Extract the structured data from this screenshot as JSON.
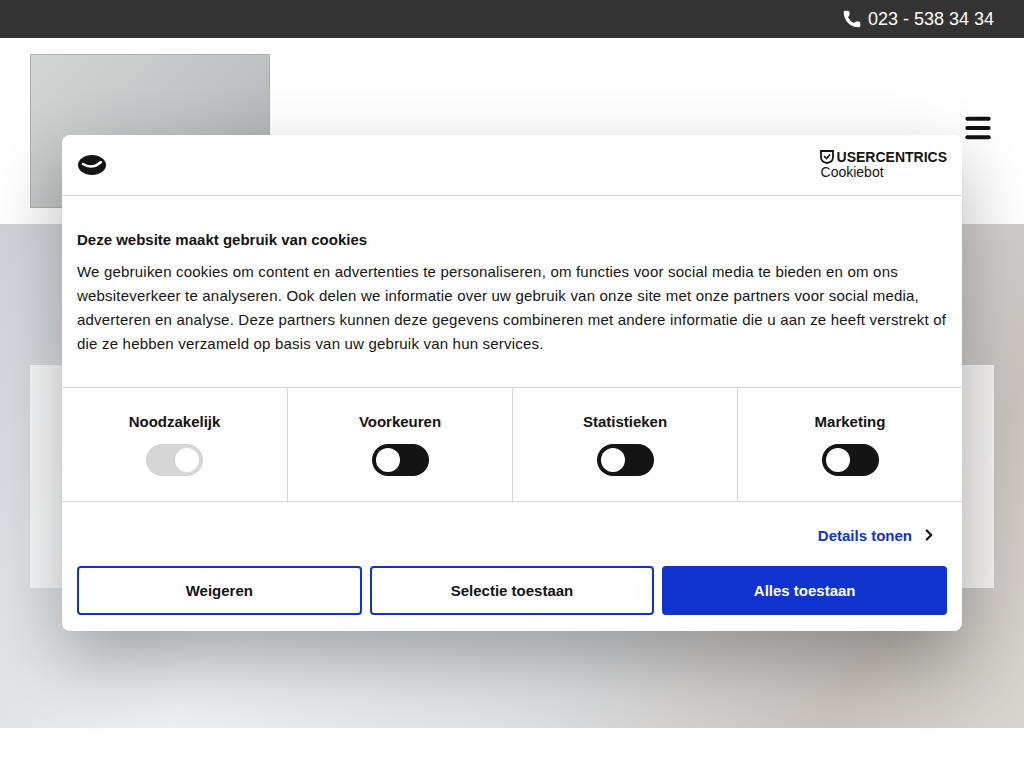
{
  "topbar": {
    "phone": "023 - 538 34 34"
  },
  "cookie_dialog": {
    "brand": {
      "name": "USERCENTRICS",
      "product": "Cookiebot"
    },
    "title": "Deze website maakt gebruik van cookies",
    "body": "We gebruiken cookies om content en advertenties te personaliseren, om functies voor social media te bieden en om ons websiteverkeer te analyseren. Ook delen we informatie over uw gebruik van onze site met onze partners voor social media, adverteren en analyse. Deze partners kunnen deze gegevens combineren met andere informatie die u aan ze heeft verstrekt of die ze hebben verzameld op basis van uw gebruik van hun services.",
    "categories": [
      {
        "label": "Noodzakelijk",
        "on": true,
        "disabled": true
      },
      {
        "label": "Voorkeuren",
        "on": false,
        "disabled": false
      },
      {
        "label": "Statistieken",
        "on": false,
        "disabled": false
      },
      {
        "label": "Marketing",
        "on": false,
        "disabled": false
      }
    ],
    "details_link": "Details tonen",
    "buttons": [
      {
        "label": "Weigeren",
        "kind": "outline"
      },
      {
        "label": "Selectie toestaan",
        "kind": "outline"
      },
      {
        "label": "Alles toestaan",
        "kind": "primary"
      }
    ]
  }
}
